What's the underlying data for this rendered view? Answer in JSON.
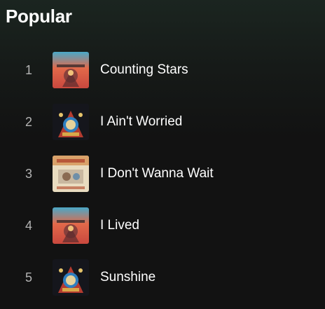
{
  "section": {
    "title": "Popular"
  },
  "tracks": [
    {
      "rank": "1",
      "title": "Counting Stars",
      "artwork_icon": "album-art-sunset-icon"
    },
    {
      "rank": "2",
      "title": "I Ain't Worried",
      "artwork_icon": "album-art-dark-carnival-icon"
    },
    {
      "rank": "3",
      "title": "I Don't Wanna Wait",
      "artwork_icon": "album-art-light-icon"
    },
    {
      "rank": "4",
      "title": "I Lived",
      "artwork_icon": "album-art-sunset-icon"
    },
    {
      "rank": "5",
      "title": "Sunshine",
      "artwork_icon": "album-art-dark-carnival-icon"
    }
  ],
  "colors": {
    "background": "#121212",
    "header_tint": "#1b2520",
    "text_primary": "#ffffff",
    "text_secondary": "#b3b3b3"
  }
}
